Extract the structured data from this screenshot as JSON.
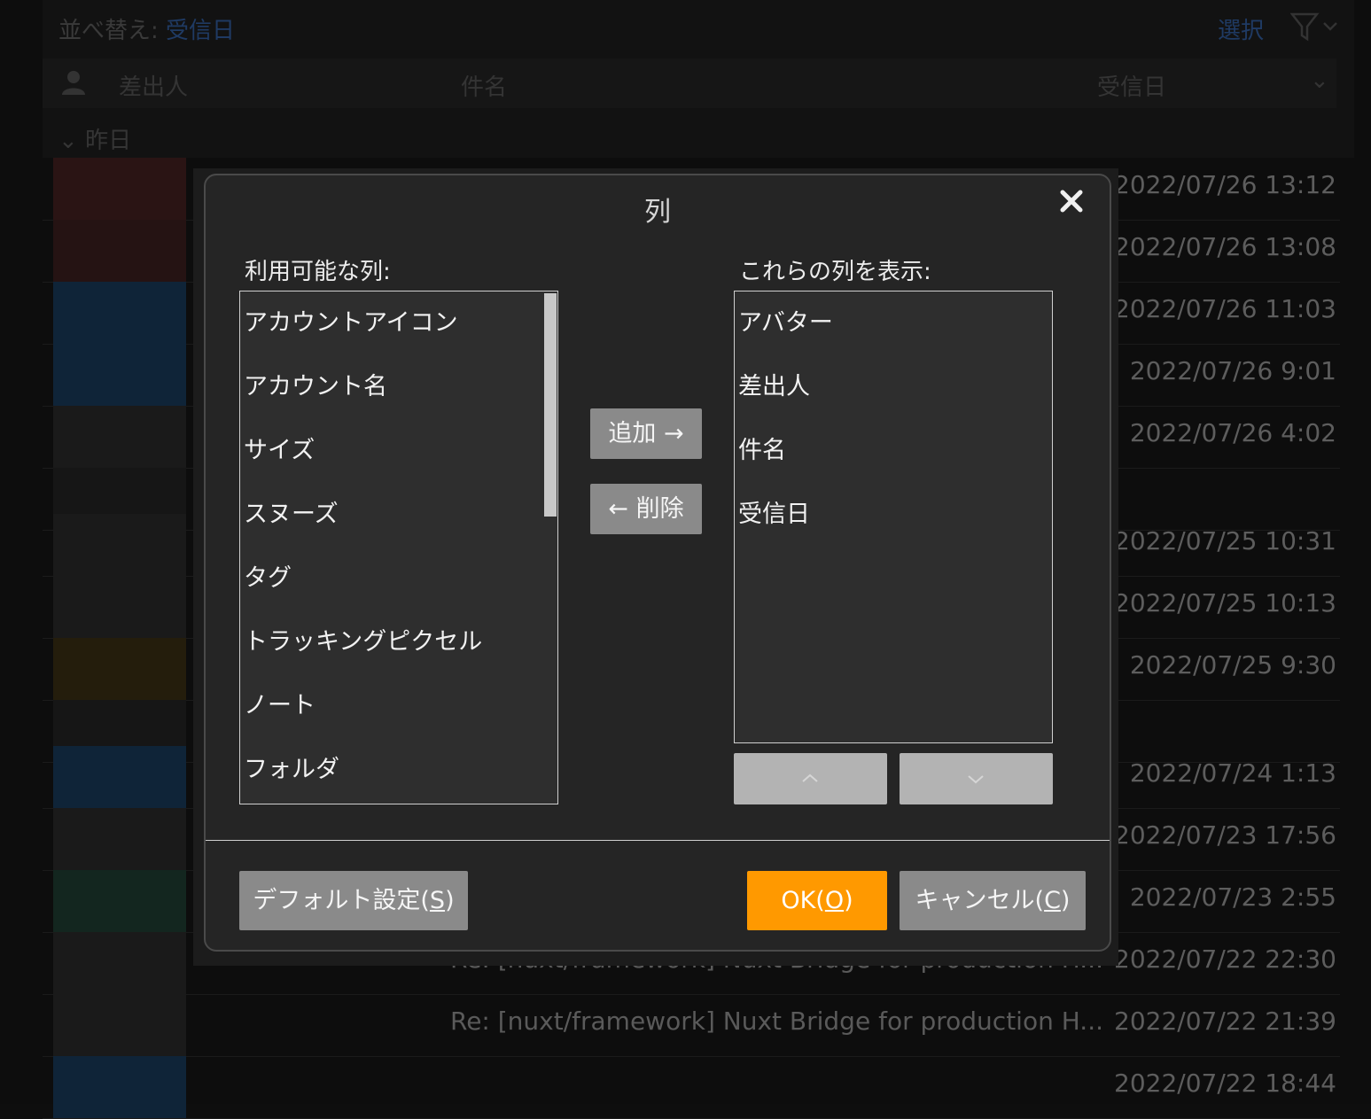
{
  "background": {
    "sort_label": "並べ替え:",
    "sort_value": "受信日",
    "select_label": "選択",
    "columns": {
      "sender": "差出人",
      "subject": "件名",
      "received": "受信日"
    },
    "group_label": "昨日",
    "rows": [
      {
        "date": "2022/07/26 13:12",
        "subject": ""
      },
      {
        "date": "2022/07/26 13:08",
        "subject": ""
      },
      {
        "date": "2022/07/26 11:03",
        "subject": ""
      },
      {
        "date": "2022/07/26 9:01",
        "subject": ""
      },
      {
        "date": "2022/07/26 4:02",
        "subject": ""
      },
      {
        "date": "",
        "subject": ""
      },
      {
        "date": "2022/07/25 10:31",
        "subject": ""
      },
      {
        "date": "2022/07/25 10:13",
        "subject": ""
      },
      {
        "date": "2022/07/25 9:30",
        "subject": ""
      },
      {
        "date": "",
        "subject": ""
      },
      {
        "date": "2022/07/24 1:13",
        "subject": ""
      },
      {
        "date": "2022/07/23 17:56",
        "subject": ""
      },
      {
        "date": "2022/07/23 2:55",
        "subject": ""
      },
      {
        "date": "2022/07/22 22:30",
        "subject": "Re: [nuxt/framework] Nuxt Bridge for production H..."
      },
      {
        "date": "2022/07/22 21:39",
        "subject": "Re: [nuxt/framework] Nuxt Bridge for production H..."
      },
      {
        "date": "2022/07/22 18:44",
        "subject": ""
      }
    ]
  },
  "dialog": {
    "title": "列",
    "available_label": "利用可能な列:",
    "shown_label": "これらの列を表示:",
    "available_items": [
      "アカウントアイコン",
      "アカウント名",
      "サイズ",
      "スヌーズ",
      "タグ",
      "トラッキングピクセル",
      "ノート",
      "フォルダ"
    ],
    "shown_items": [
      "アバター",
      "差出人",
      "件名",
      "受信日"
    ],
    "add_button": "追加 →",
    "remove_button": "← 削除",
    "default_button": "デフォルト設定(",
    "default_key": "S",
    "ok_button": "OK(",
    "ok_key": "O",
    "cancel_button": "キャンセル(",
    "cancel_key": "C",
    "close_paren": ")"
  }
}
